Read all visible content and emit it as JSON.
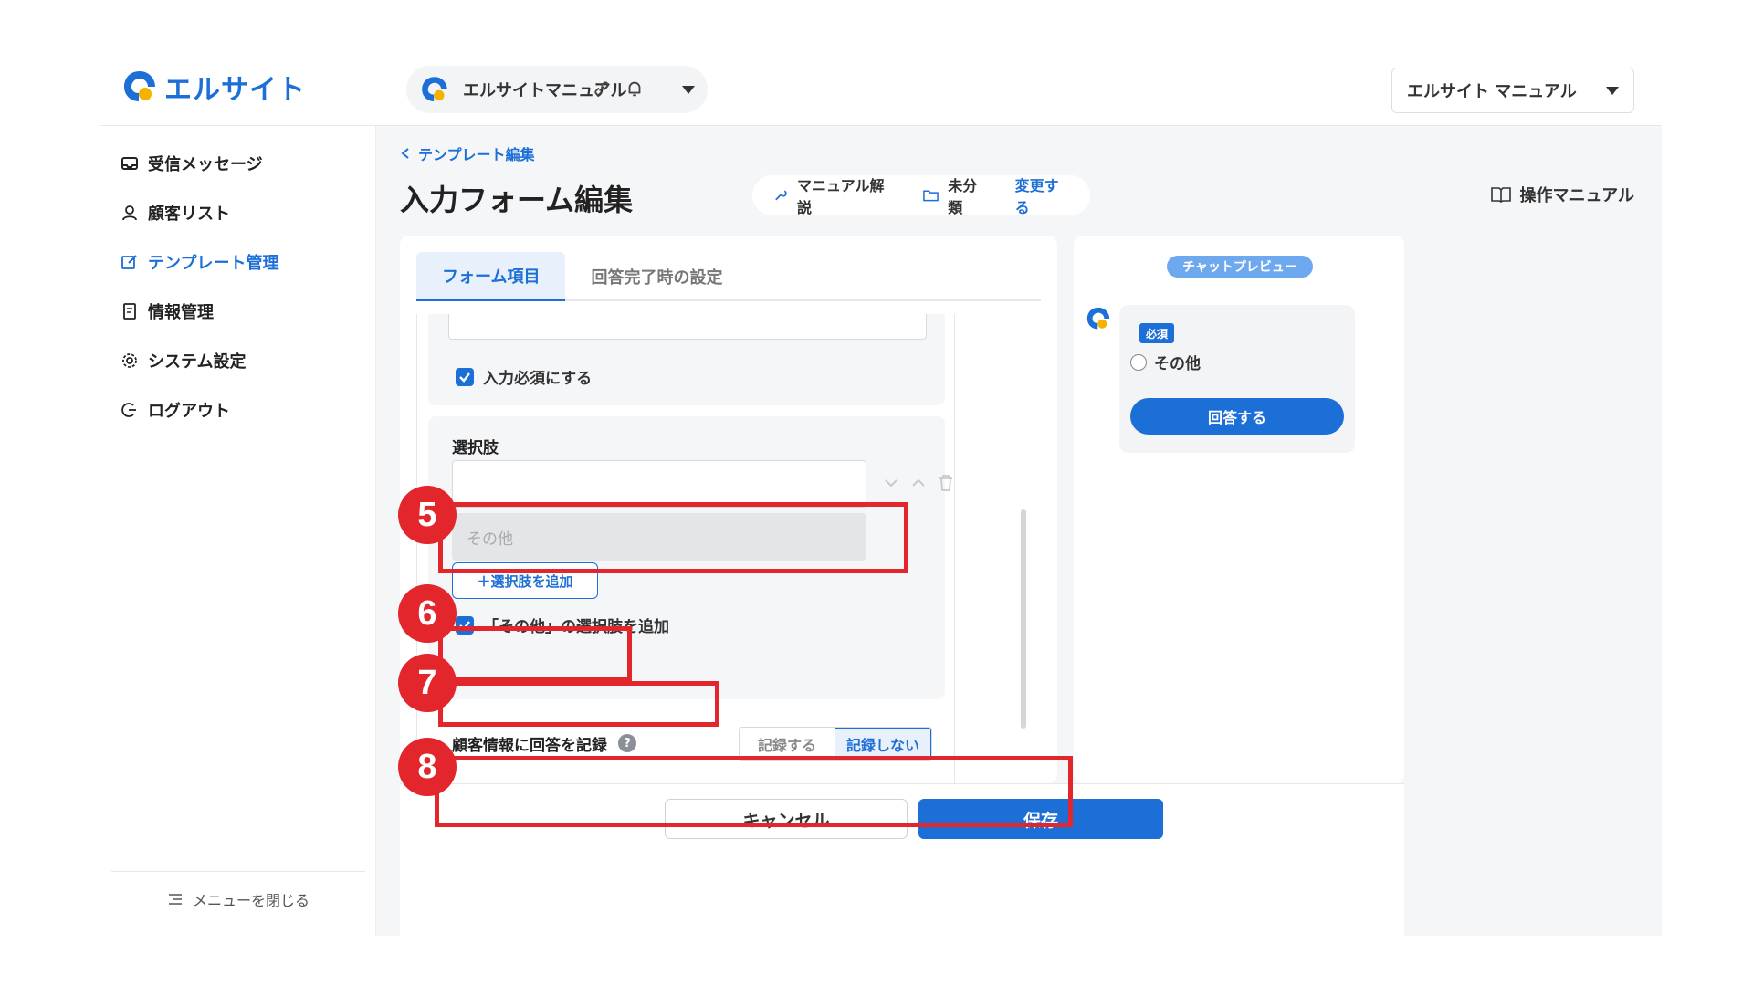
{
  "header": {
    "logo_text": "エルサイト",
    "account_name": "エルサイトマニュアル",
    "user_menu_label": "エルサイト マニュアル"
  },
  "sidebar": {
    "items": [
      {
        "label": "受信メッセージ",
        "icon": "inbox-icon",
        "active": false
      },
      {
        "label": "顧客リスト",
        "icon": "user-icon",
        "active": false
      },
      {
        "label": "テンプレート管理",
        "icon": "edit-icon",
        "active": true
      },
      {
        "label": "情報管理",
        "icon": "document-icon",
        "active": false
      },
      {
        "label": "システム設定",
        "icon": "gear-icon",
        "active": false
      },
      {
        "label": "ログアウト",
        "icon": "logout-icon",
        "active": false
      }
    ],
    "close_menu_label": "メニューを閉じる"
  },
  "page": {
    "breadcrumb": "テンプレート編集",
    "title": "入力フォーム編集",
    "manual_commentary": "マニュアル解説",
    "folder": "未分類",
    "change_link": "変更する",
    "manual_link": "操作マニュアル"
  },
  "tabs": [
    {
      "label": "フォーム項目",
      "active": true
    },
    {
      "label": "回答完了時の設定",
      "active": false
    }
  ],
  "form": {
    "required_label": "入力必須にする",
    "options_label": "選択肢",
    "option_value": "",
    "other_option": "その他",
    "add_option_button": "＋選択肢を追加",
    "add_other_label": "「その他」の選択肢を追加",
    "record_label": "顧客情報に回答を記録",
    "record_yes": "記録する",
    "record_no": "記録しない",
    "help_glyph": "?"
  },
  "preview": {
    "badge": "チャットプレビュー",
    "required_badge": "必須",
    "radio_option": "その他",
    "answer_button": "回答する"
  },
  "footer": {
    "cancel_button": "キャンセル",
    "save_button": "保存"
  },
  "annotations": {
    "step5": "5",
    "step6": "6",
    "step7": "7",
    "step8": "8"
  },
  "colors": {
    "accent": "#1d6fd8",
    "annotation_red": "#e2262c"
  }
}
